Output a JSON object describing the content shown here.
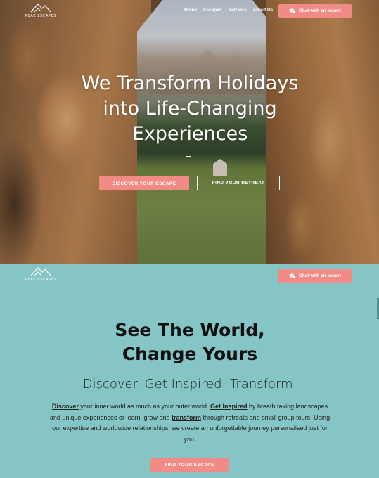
{
  "brand": {
    "logo_text": "PEAK ESCAPES"
  },
  "nav": {
    "items": [
      "Home",
      "Escapes",
      "Retreats",
      "About Us"
    ]
  },
  "chat_button": {
    "label": "Chat with an expert",
    "icon": "chat-bubbles-icon"
  },
  "hero": {
    "title_lines": [
      "We Transform Holidays",
      "into Life-Changing",
      "Experiences"
    ],
    "primary_button": "DISCOVER YOUR ESCAPE",
    "secondary_button": "FIND YOUR RETREAT"
  },
  "intro": {
    "title_lines": [
      "See The World,",
      "Change Yours"
    ],
    "subtitle": "Discover. Get Inspired. Transform.",
    "body": {
      "kw1": "Discover",
      "t1": " your inner world as much as your outer world. ",
      "kw2": "Get Inspired",
      "t2": " by breath taking landscapes and unique experiences or learn, grow and ",
      "kw3": "transform",
      "t3": " through retreats and small group tours. Using our expertise and worldwide relationships, we create an unforgettable journey personalised just for you."
    },
    "button": "FIND YOUR ESCAPE"
  },
  "colors": {
    "accent": "#f28b86",
    "teal_background": "#86c5c6",
    "text_dark": "#111111",
    "white": "#ffffff"
  }
}
